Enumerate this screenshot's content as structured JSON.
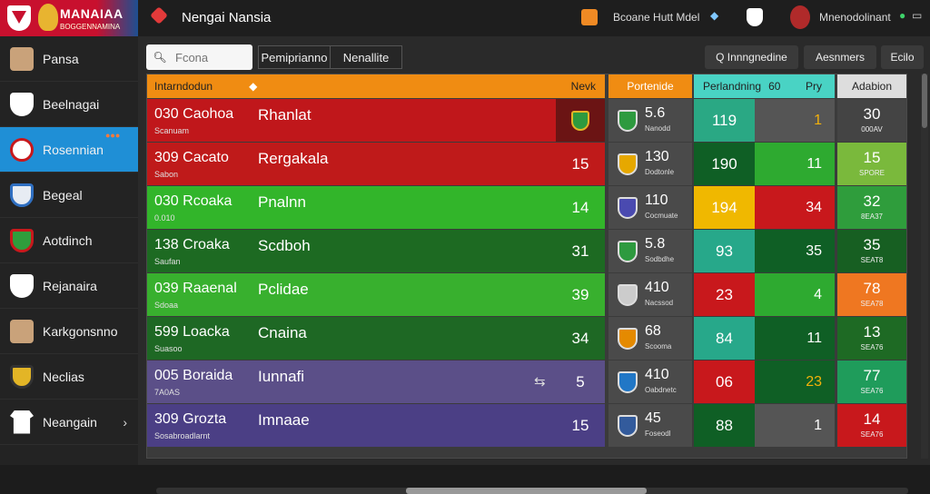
{
  "app": {
    "brand_title": "MANAIAA",
    "brand_sub": "BOGGENNAMINA",
    "window_title": "Nengai Nansia"
  },
  "topbar": {
    "match_label": "Bcoane Hutt Mdel",
    "user_name": "Mnenodolinant"
  },
  "sidebar": {
    "items": [
      {
        "label": "Pansa",
        "icon": "player-avatar-icon"
      },
      {
        "label": "Beelnagai",
        "icon": "shield-icon"
      },
      {
        "label": "Rosennian",
        "icon": "badge-icon",
        "active": true,
        "badge": "●●●"
      },
      {
        "label": "Begeal",
        "icon": "club-crest-icon"
      },
      {
        "label": "Aotdinch",
        "icon": "club-crest-icon"
      },
      {
        "label": "Rejanaira",
        "icon": "shield-icon"
      },
      {
        "label": "Karkgonsnno",
        "icon": "player-avatar-icon"
      },
      {
        "label": "Neclias",
        "icon": "club-crest-icon"
      },
      {
        "label": "Neangain",
        "icon": "shirt-icon",
        "chevron": "›"
      }
    ]
  },
  "toolbar": {
    "search_placeholder": "Fcona",
    "tab1": "Pemiprianno",
    "tab2": "Nenallite",
    "btn1": "Q Innngnedine",
    "btn2": "Aesnmers",
    "btn3": "Ecilo"
  },
  "table": {
    "headers": {
      "name": "Intarndodun",
      "week": "Nevk",
      "match": "Portenide",
      "perf": "Perlandning",
      "perf_val": "60",
      "ply": "Pry",
      "act": "Adabion"
    },
    "rows": [
      {
        "code": "030 Caohoa",
        "sub": "Scanuam",
        "team": "Rhanlat",
        "week": "",
        "score": "5.6",
        "score_sub": "Nanodd",
        "perf": "119",
        "ply": "1",
        "act": "30",
        "act_sub": "000AV"
      },
      {
        "code": "309 Cacato",
        "sub": "Sabon",
        "team": "Rergakala",
        "week": "15",
        "score": "130",
        "score_sub": "Dodtonle",
        "perf": "190",
        "ply": "11",
        "act": "15",
        "act_sub": "SPORE"
      },
      {
        "code": "030 Rcoaka",
        "sub": "0.010",
        "team": "Pnalnn",
        "week": "14",
        "score": "110",
        "score_sub": "Cocmuate",
        "perf": "194",
        "ply": "34",
        "act": "32",
        "act_sub": "8EA37"
      },
      {
        "code": "138 Croaka",
        "sub": "Saufan",
        "team": "Scdboh",
        "week": "31",
        "score": "5.8",
        "score_sub": "Sodbdhe",
        "perf": "93",
        "ply": "35",
        "act": "35",
        "act_sub": "SEAT8"
      },
      {
        "code": "039 Raaenal",
        "sub": "Sdoaa",
        "team": "Pclidae",
        "week": "39",
        "score": "410",
        "score_sub": "Nacssod",
        "perf": "23",
        "ply": "4",
        "act": "78",
        "act_sub": "SEA78"
      },
      {
        "code": "599 Loacka",
        "sub": "Suasoo",
        "team": "Cnaina",
        "week": "34",
        "score": "68",
        "score_sub": "Scooma",
        "perf": "84",
        "ply": "11",
        "act": "13",
        "act_sub": "SEA76"
      },
      {
        "code": "005 Boraida",
        "sub": "7A0AS",
        "team": "Iunnafi",
        "week": "5",
        "score": "410",
        "score_sub": "Oabdnetc",
        "perf": "06",
        "ply": "23",
        "act": "77",
        "act_sub": "SEA76"
      },
      {
        "code": "309 Grozta",
        "sub": "Sosabroadlarnt",
        "team": "Imnaae",
        "week": "15",
        "score": "45",
        "score_sub": "Foseodl",
        "perf": "88",
        "ply": "1",
        "act": "14",
        "act_sub": "SEA76"
      }
    ]
  },
  "colors": {
    "row_bg": [
      "#c0171b",
      "#bf1a1a",
      "#32b52a",
      "#1d6a22",
      "#38b02e",
      "#1e6824",
      "#5b4f88",
      "#4b3f85"
    ],
    "perf_bg": [
      "#2aa884",
      "#0f5f25",
      "#f0b800",
      "#27a88a",
      "#c8181c",
      "#27a88a",
      "#c8181c",
      "#0f5f25"
    ],
    "ply_bg": [
      "#555555",
      "#2eaa30",
      "#c8181c",
      "#0f5f25",
      "#2eaa30",
      "#0f5f25",
      "#0f5f25",
      "#555555"
    ],
    "ply_fg": [
      "#f3b10a",
      "#ffffff",
      "#ffffff",
      "#ffffff",
      "#ffffff",
      "#ffffff",
      "#f3b10a",
      "#ffffff"
    ],
    "act_bg": [
      "#444444",
      "#7ab93c",
      "#2f9d3c",
      "#175f22",
      "#ef7721",
      "#1e6a24",
      "#1f9c5b",
      "#c8181c"
    ],
    "crest": [
      "#2e9a3f",
      "#e6a800",
      "#4a4ab0",
      "#2e9a3f",
      "#cccccc",
      "#e58a00",
      "#2177c6",
      "#335b9c"
    ]
  }
}
